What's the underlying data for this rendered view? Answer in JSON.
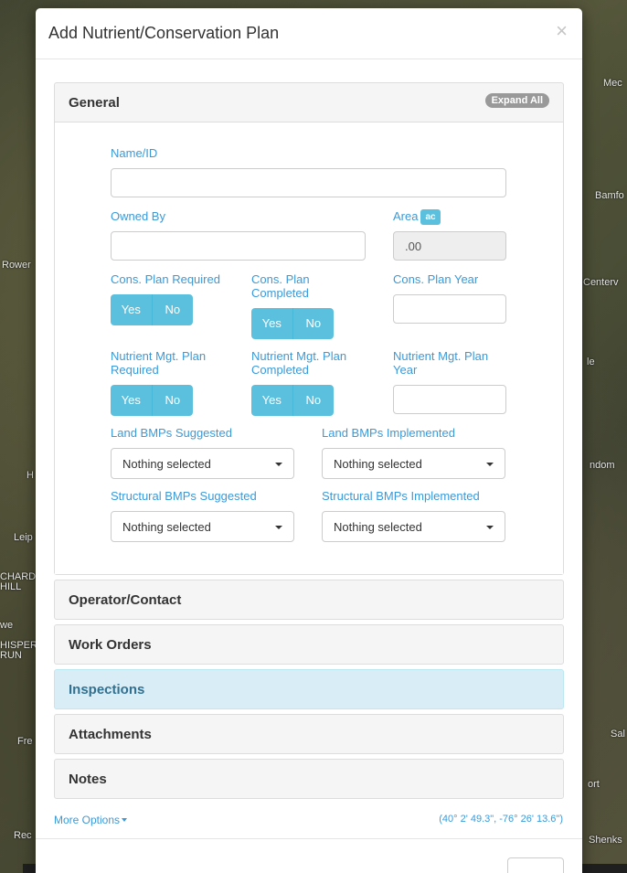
{
  "map": {
    "labels": [
      "Mec",
      "Bamfo",
      "Rower",
      "Centerv",
      "le",
      "ndom",
      "H",
      "Leip",
      "CHARD",
      "HILL",
      "we",
      "HISPER",
      "RUN",
      "Fre",
      "Sal",
      "ort",
      "Rec",
      "Shenks"
    ]
  },
  "modal": {
    "title": "Add Nutrient/Conservation Plan",
    "close": "×"
  },
  "general": {
    "title": "General",
    "expand_all": "Expand All",
    "name_label": "Name/ID",
    "name_value": "",
    "owned_by_label": "Owned By",
    "owned_by_value": "",
    "area_label": "Area",
    "area_unit": "ac",
    "area_value": ".00",
    "cons_required_label": "Cons. Plan Required",
    "cons_completed_label": "Cons. Plan Completed",
    "cons_year_label": "Cons. Plan Year",
    "nutrient_required_label": "Nutrient Mgt. Plan Required",
    "nutrient_completed_label": "Nutrient Mgt. Plan Completed",
    "nutrient_year_label": "Nutrient Mgt. Plan Year",
    "yes": "Yes",
    "no": "No",
    "land_suggested_label": "Land BMPs Suggested",
    "land_implemented_label": "Land BMPs Implemented",
    "structural_suggested_label": "Structural BMPs Suggested",
    "structural_implemented_label": "Structural BMPs Implemented",
    "nothing_selected": "Nothing selected"
  },
  "panels": {
    "operator": "Operator/Contact",
    "work_orders": "Work Orders",
    "inspections": "Inspections",
    "attachments": "Attachments",
    "notes": "Notes"
  },
  "footer": {
    "more_options": "More Options",
    "coords": "(40° 2' 49.3\", -76° 26' 13.6\")"
  }
}
